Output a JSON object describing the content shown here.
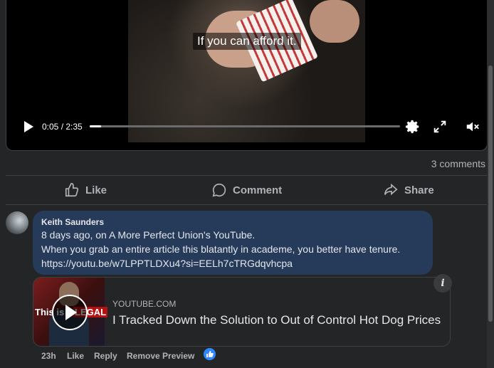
{
  "video": {
    "caption": "If you can afford it.",
    "time": "0:05 / 2:35",
    "progress_fraction": 0.036
  },
  "post": {
    "comments_count": "3 comments",
    "actions": {
      "like": "Like",
      "comment": "Comment",
      "share": "Share"
    }
  },
  "comment": {
    "author": "Keith Saunders",
    "lines": [
      "8 days ago, on A More Perfect Union's YouTube.",
      "When you grab an entire article this blatantly in academe, you better have tenure.",
      "https://youtu.be/w7LPPTLDXu4?si=EELh7cTRGdqvhcpa"
    ],
    "preview": {
      "domain": "YOUTUBE.COM",
      "title": "I Tracked Down the Solution to Out of Control Hot Dog Prices",
      "thumb_text_left": "This is",
      "thumb_text_right": "LEGAL",
      "info": "i"
    },
    "meta": {
      "time": "23h",
      "like": "Like",
      "reply": "Reply",
      "remove_preview": "Remove Preview"
    }
  },
  "colors": {
    "bubble": "#263b5a",
    "accent": "#2d88ff"
  },
  "icons": [
    "play-icon",
    "settings-icon",
    "fullscreen-icon",
    "mute-icon",
    "like-icon",
    "comment-icon",
    "share-icon",
    "info-icon"
  ]
}
